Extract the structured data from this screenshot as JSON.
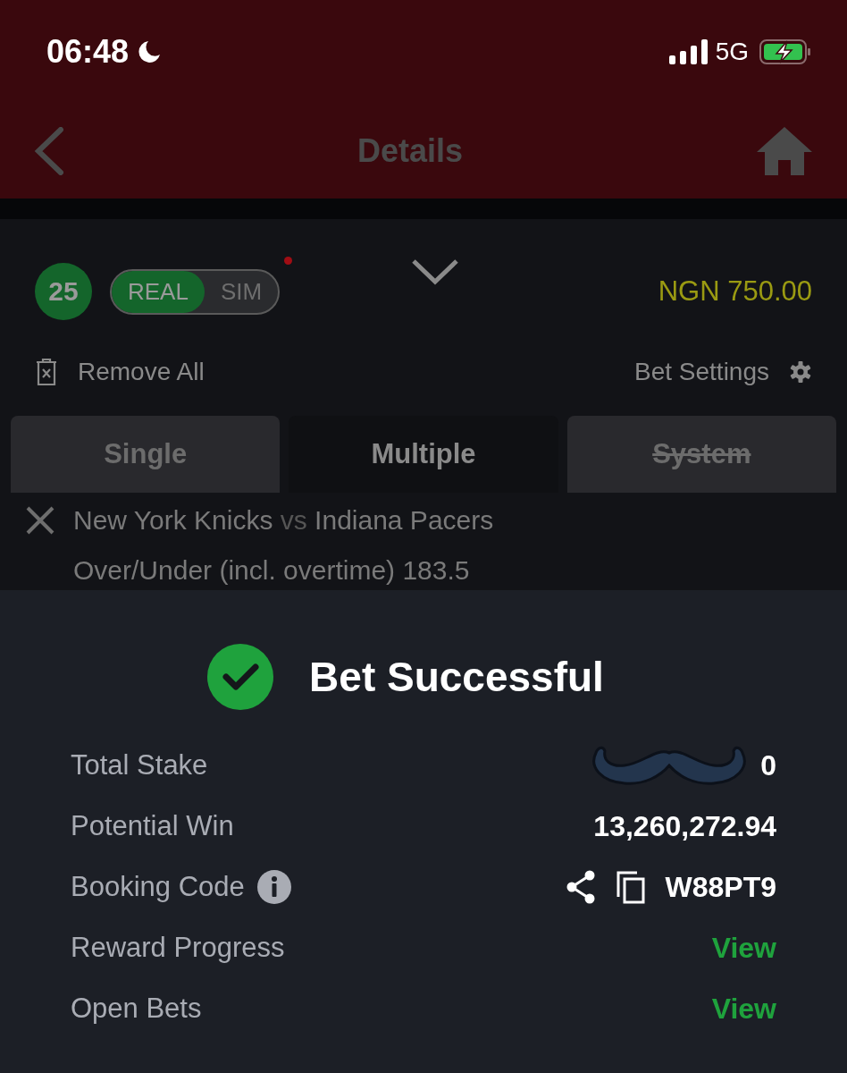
{
  "status_bar": {
    "time": "06:48",
    "network": "5G"
  },
  "header": {
    "title": "Details"
  },
  "betslip": {
    "count": "25",
    "mode_toggle": [
      {
        "label": "REAL",
        "selected": true
      },
      {
        "label": "SIM",
        "selected": false
      }
    ],
    "balance": "NGN 750.00",
    "remove_all": "Remove All",
    "bet_settings": "Bet Settings",
    "tabs": [
      {
        "label": "Single",
        "selected": false,
        "disabled": false
      },
      {
        "label": "Multiple",
        "selected": true,
        "disabled": false
      },
      {
        "label": "System",
        "selected": false,
        "disabled": true
      }
    ],
    "selection": {
      "home": "New York Knicks",
      "vs": "vs",
      "away": "Indiana Pacers",
      "market": "Over/Under (incl. overtime) 183.5"
    }
  },
  "result": {
    "title": "Bet Successful",
    "rows": [
      {
        "label": "Total Stake",
        "value": "0",
        "kind": "hidden"
      },
      {
        "label": "Potential Win",
        "value": "13,260,272.94",
        "kind": "amount"
      },
      {
        "label": "Booking Code",
        "value": "W88PT9",
        "kind": "code"
      },
      {
        "label": "Reward Progress",
        "value": "View",
        "kind": "link"
      },
      {
        "label": "Open Bets",
        "value": "View",
        "kind": "link"
      }
    ]
  }
}
